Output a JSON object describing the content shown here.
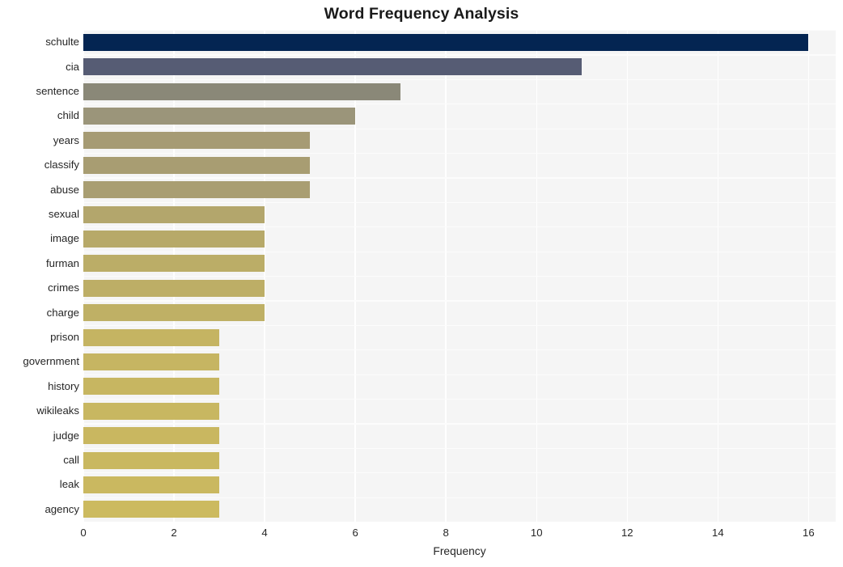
{
  "chart_data": {
    "type": "bar",
    "orientation": "horizontal",
    "title": "Word Frequency Analysis",
    "xlabel": "Frequency",
    "ylabel": "",
    "xlim": [
      0,
      16.6
    ],
    "ylim": [
      0,
      20
    ],
    "grid": true,
    "legend": null,
    "xticks": [
      "0",
      "2",
      "4",
      "6",
      "8",
      "10",
      "12",
      "14",
      "16"
    ],
    "xtick_values": [
      0,
      2,
      4,
      6,
      8,
      10,
      12,
      14,
      16
    ],
    "categories": [
      "schulte",
      "cia",
      "sentence",
      "child",
      "years",
      "classify",
      "abuse",
      "sexual",
      "image",
      "furman",
      "crimes",
      "charge",
      "prison",
      "government",
      "history",
      "wikileaks",
      "judge",
      "call",
      "leak",
      "agency"
    ],
    "values": [
      16,
      11,
      7,
      6,
      5,
      5,
      5,
      4,
      4,
      4,
      4,
      4,
      3,
      3,
      3,
      3,
      3,
      3,
      3,
      3
    ],
    "bar_colors": [
      "#042552",
      "#565c74",
      "#8a8878",
      "#9b957a",
      "#a69b74",
      "#a89d72",
      "#a99e72",
      "#b3a66c",
      "#b7a969",
      "#bbad67",
      "#bdae66",
      "#bfb065",
      "#c5b462",
      "#c6b562",
      "#c7b661",
      "#c8b761",
      "#c9b760",
      "#c9b860",
      "#cab860",
      "#ccba5f"
    ],
    "plot_bgcolor": "#f5f5f5",
    "figure_bgcolor": "#ffffff",
    "gridline_color": "#ffffff"
  },
  "figure": {
    "title": "Word Frequency Analysis",
    "axis_label_x": "Frequency"
  }
}
